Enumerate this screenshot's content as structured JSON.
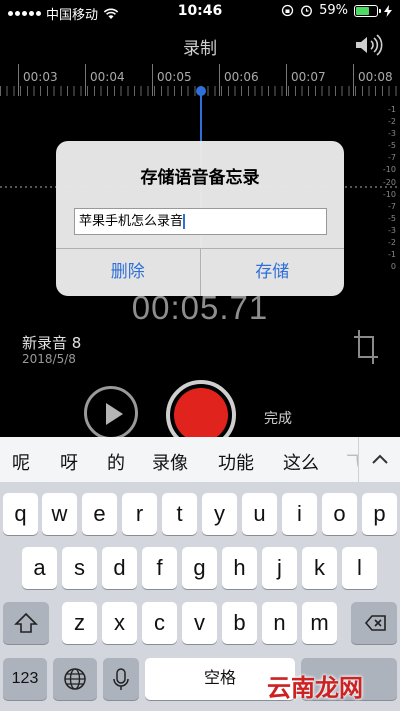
{
  "status_bar": {
    "carrier": "中国移动",
    "time": "10:46",
    "battery": "59%"
  },
  "nav": {
    "title": "录制"
  },
  "timeline": {
    "labels": [
      "00:03",
      "00:04",
      "00:05",
      "00:06",
      "00:07",
      "00:08"
    ]
  },
  "db_scale": [
    "-1",
    "-2",
    "-3",
    "-5",
    "-7",
    "-10",
    "-20",
    "-10",
    "-7",
    "-5",
    "-3",
    "-2",
    "-1",
    "0"
  ],
  "dialog": {
    "title": "存储语音备忘录",
    "input_value": "苹果手机怎么录音",
    "delete_label": "删除",
    "save_label": "存储"
  },
  "recording": {
    "elapsed": "00:05.71",
    "name": "新录音 8",
    "date": "2018/5/8",
    "done_label": "完成"
  },
  "suggestions": [
    "呢",
    "呀",
    "的",
    "录像",
    "功能",
    "这么",
    "飞"
  ],
  "keyboard": {
    "row1": [
      "q",
      "w",
      "e",
      "r",
      "t",
      "y",
      "u",
      "i",
      "o",
      "p"
    ],
    "row2": [
      "a",
      "s",
      "d",
      "f",
      "g",
      "h",
      "j",
      "k",
      "l"
    ],
    "row3": [
      "z",
      "x",
      "c",
      "v",
      "b",
      "n",
      "m"
    ],
    "numbers_label": "123",
    "space_label": "空格"
  },
  "watermark": "云南龙网",
  "colors": {
    "accent": "#2e6fd8",
    "record": "#e0241d",
    "battery": "#4cd964"
  }
}
